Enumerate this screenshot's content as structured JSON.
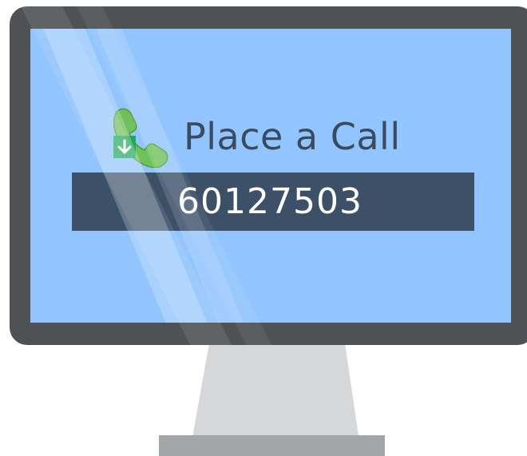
{
  "screen": {
    "title": "Place a Call",
    "number": "60127503"
  },
  "colors": {
    "bezel": "#4f5255",
    "screen": "#92c4fd",
    "number_bar": "#3c5068",
    "title_text": "#3b4b5f",
    "phone_green": "#6fc25a",
    "badge_green": "#1fa85a",
    "stand": "#d6d7d9",
    "base": "#a3a6a8"
  },
  "icons": {
    "phone": "phone-icon",
    "badge": "download-arrow-icon"
  }
}
